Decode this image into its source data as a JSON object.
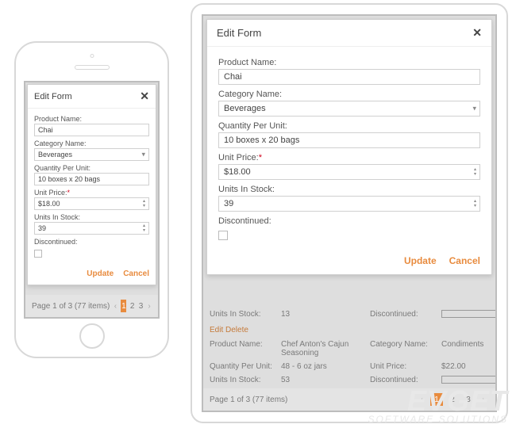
{
  "modal": {
    "title": "Edit Form",
    "labels": {
      "product_name": "Product Name:",
      "category_name": "Category Name:",
      "qty_per_unit": "Quantity Per Unit:",
      "unit_price": "Unit Price:",
      "units_in_stock": "Units In Stock:",
      "discontinued": "Discontinued:"
    },
    "values": {
      "product_name": "Chai",
      "category_name": "Beverages",
      "qty_per_unit": "10 boxes x 20 bags",
      "unit_price": "$18.00",
      "units_in_stock": "39",
      "discontinued": false
    },
    "buttons": {
      "update": "Update",
      "cancel": "Cancel"
    },
    "required_marker": "*"
  },
  "tablet_bg": {
    "row1": {
      "c1": "Units In Stock:",
      "c2": "13",
      "c3": "Discontinued:"
    },
    "edit_delete": "Edit  Delete",
    "row2": {
      "c1": "Product Name:",
      "c2": "Chef Anton's Cajun Seasoning",
      "c3": "Category Name:",
      "c4": "Condiments"
    },
    "row3": {
      "c1": "Quantity Per Unit:",
      "c2": "48 - 6 oz jars",
      "c3": "Unit Price:",
      "c4": "$22.00"
    },
    "row4": {
      "c1": "Units In Stock:",
      "c2": "53",
      "c3": "Discontinued:"
    }
  },
  "pager": {
    "label": "Page 1 of 3 (77 items)",
    "pages": [
      "1",
      "2",
      "3"
    ]
  },
  "watermark": {
    "l1": "EVGET",
    "l2": "SOFTWARE SOLUTIONS"
  }
}
